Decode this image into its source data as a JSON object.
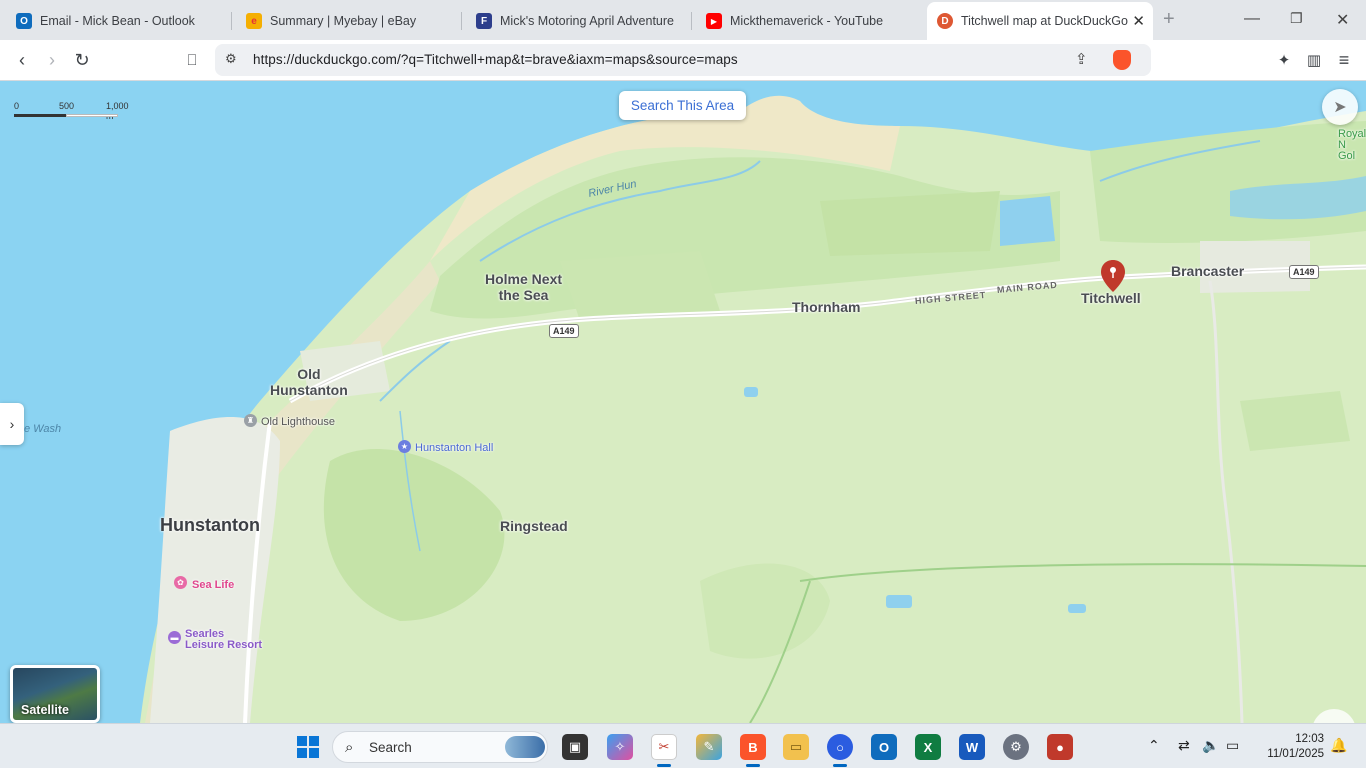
{
  "tabs": [
    {
      "title": "Email - Mick Bean - Outlook",
      "icon": "outlook-icon",
      "color": "#0f6cbd",
      "glyph": "O"
    },
    {
      "title": "Summary | Myebay | eBay",
      "icon": "ebay-icon",
      "color": "#e53238",
      "glyph": "e"
    },
    {
      "title": "Mick's Motoring April Adventure",
      "icon": "blog-icon",
      "color": "#2d3e8c",
      "glyph": "F"
    },
    {
      "title": "Mickthemaverick - YouTube",
      "icon": "youtube-icon",
      "color": "#ff0000",
      "glyph": "▶"
    },
    {
      "title": "Titchwell map at DuckDuckGo",
      "icon": "duckduckgo-icon",
      "color": "#de5833",
      "glyph": "D",
      "active": true
    }
  ],
  "address_bar": {
    "url": "https://duckduckgo.com/?q=Titchwell+map&t=brave&iaxm=maps&source=maps"
  },
  "map": {
    "scale": {
      "zero": "0",
      "mid": "500",
      "end": "1,000 m"
    },
    "search_area_label": "Search This Area",
    "satellite_label": "Satellite",
    "places": {
      "holme": "Holme Next\nthe Sea",
      "thornham": "Thornham",
      "titchwell": "Titchwell",
      "brancaster": "Brancaster",
      "old_hunstanton": "Old\nHunstanton",
      "hunstanton": "Hunstanton",
      "ringstead": "Ringstead",
      "royal": "Royal\nN\nGol",
      "wash": "e Wash",
      "river": "River Hun"
    },
    "pois": {
      "lighthouse": "Old Lighthouse",
      "hall": "Hunstanton Hall",
      "sealife": "Sea Life",
      "searles": "Searles\nLeisure Resort"
    },
    "roads": {
      "high_street": "HIGH STREET",
      "main_road": "MAIN ROAD",
      "a149_west": "A149",
      "a149_east": "A149"
    },
    "colors": {
      "sea": "#8bd3f2",
      "land": "#d8ecc2",
      "pin": "#c0392b"
    }
  },
  "taskbar": {
    "search_placeholder": "Search",
    "time": "12:03",
    "date": "11/01/2025"
  }
}
